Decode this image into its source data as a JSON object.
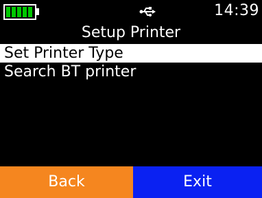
{
  "status_bar": {
    "battery_level": 1.0,
    "battery_color": "#00c800",
    "usb_icon": "usb-icon",
    "time": "14:39"
  },
  "screen": {
    "title": "Setup Printer"
  },
  "menu": {
    "items": [
      {
        "label": "Set Printer Type",
        "selected": true
      },
      {
        "label": "Search BT printer",
        "selected": false
      }
    ]
  },
  "softkeys": {
    "left_label": "Back",
    "left_color": "#f5861f",
    "right_label": "Exit",
    "right_color": "#0a21f2"
  }
}
